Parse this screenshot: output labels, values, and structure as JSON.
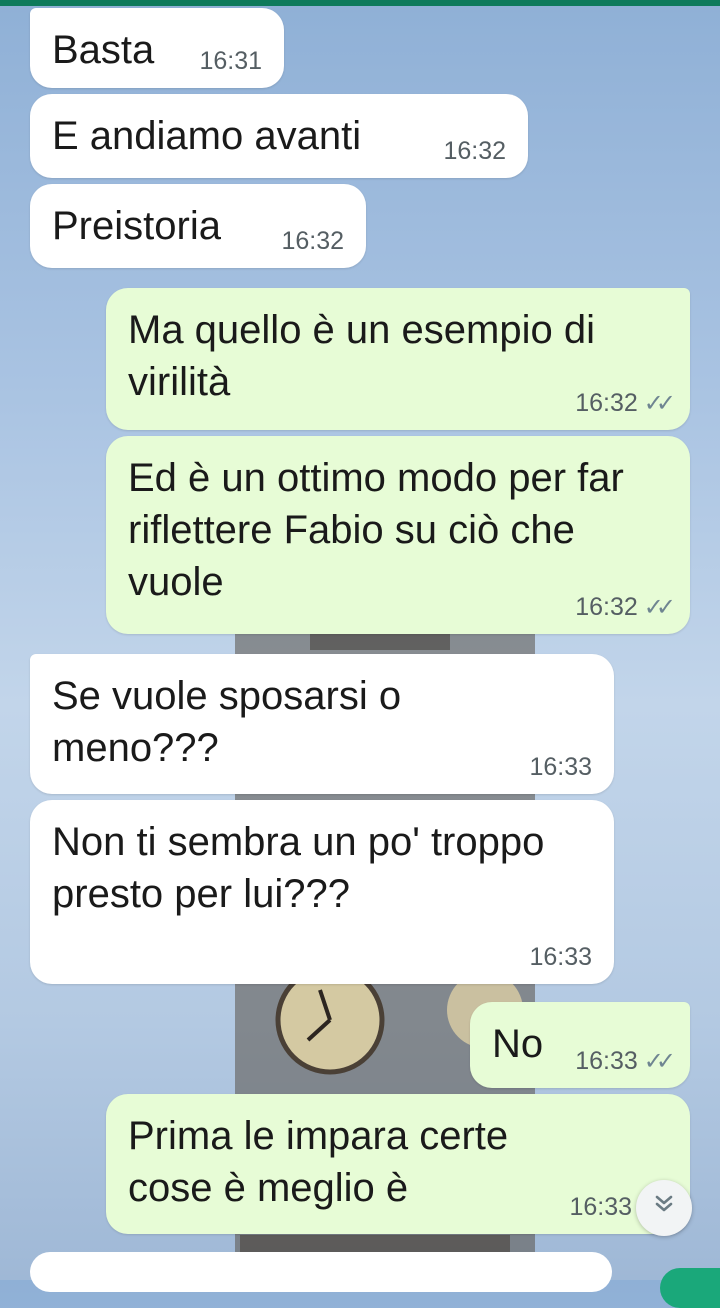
{
  "messages": [
    {
      "id": "m1",
      "dir": "in",
      "text": "Basta",
      "time": "16:31"
    },
    {
      "id": "m2",
      "dir": "in",
      "text": "E andiamo avanti",
      "time": "16:32"
    },
    {
      "id": "m3",
      "dir": "in",
      "text": "Preistoria",
      "time": "16:32"
    },
    {
      "id": "m4",
      "dir": "out",
      "text": "Ma quello è un esempio di virilità",
      "time": "16:32",
      "status": "read"
    },
    {
      "id": "m5",
      "dir": "out",
      "text": "Ed è un ottimo modo per far riflettere Fabio su ciò che vuole",
      "time": "16:32",
      "status": "read"
    },
    {
      "id": "m6",
      "dir": "in",
      "text": "Se vuole sposarsi o meno???",
      "time": "16:33"
    },
    {
      "id": "m7",
      "dir": "in",
      "text": "Non ti sembra un po' troppo presto per lui???",
      "time": "16:33"
    },
    {
      "id": "m8",
      "dir": "out",
      "text": "No",
      "time": "16:33",
      "status": "read"
    },
    {
      "id": "m9",
      "dir": "out",
      "text": "Prima le impara certe cose è meglio è",
      "time": "16:33",
      "status": "read"
    }
  ],
  "icons": {
    "read_ticks": "double-check-icon",
    "scroll_down": "chevron-double-down-icon"
  },
  "colors": {
    "header": "#0e7a5b",
    "incoming_bubble": "#ffffff",
    "outgoing_bubble": "#e7fcd6",
    "fab": "#1aa87a"
  }
}
